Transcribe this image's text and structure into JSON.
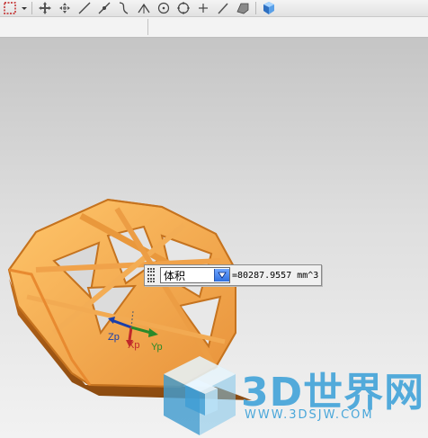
{
  "toolbar": {
    "icons": [
      "selection-box-icon",
      "dropdown-arrow-icon",
      "move-icon",
      "rotate-copy-icon",
      "line-icon",
      "line-point-icon",
      "curve-icon",
      "angle-icon",
      "circle-center-icon",
      "circle-icon",
      "point-icon",
      "slash-line-icon",
      "face-shape-icon",
      "cube-icon"
    ]
  },
  "measure": {
    "type_label": "体积",
    "value": "=80287.9557 mm^3"
  },
  "axes": {
    "z_label": "Zp",
    "x_label": "Xp",
    "y_label": "Yp"
  },
  "watermark": {
    "title": "3D世界网",
    "url": "WWW.3DSJW.COM"
  },
  "colors": {
    "part_fill": "#f7b24e",
    "part_edge": "#d9822a",
    "watermark": "#4aa7da"
  }
}
